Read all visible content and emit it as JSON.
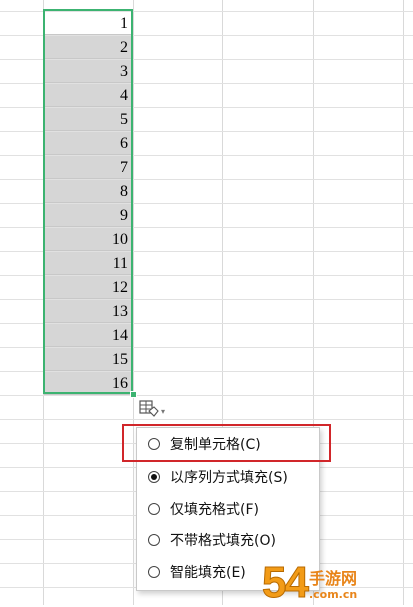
{
  "sheet": {
    "cells": [
      "1",
      "2",
      "3",
      "4",
      "5",
      "6",
      "7",
      "8",
      "9",
      "10",
      "11",
      "12",
      "13",
      "14",
      "15",
      "16"
    ],
    "selection_color": "#3cb371",
    "selected_fill": "#d6d6d6"
  },
  "autofill": {
    "icon": "autofill-options-icon",
    "dropdown_icon": "chevron-down-icon"
  },
  "menu": {
    "items": [
      {
        "label": "复制单元格(C)",
        "checked": false
      },
      {
        "label": "以序列方式填充(S)",
        "checked": true
      },
      {
        "label": "仅填充格式(F)",
        "checked": false
      },
      {
        "label": "不带格式填充(O)",
        "checked": false
      },
      {
        "label": "智能填充(E)",
        "checked": false
      }
    ],
    "highlight_color": "#d1262a"
  },
  "watermark": {
    "digits": "54",
    "name": "手游网",
    "domain": ".com.cn"
  }
}
